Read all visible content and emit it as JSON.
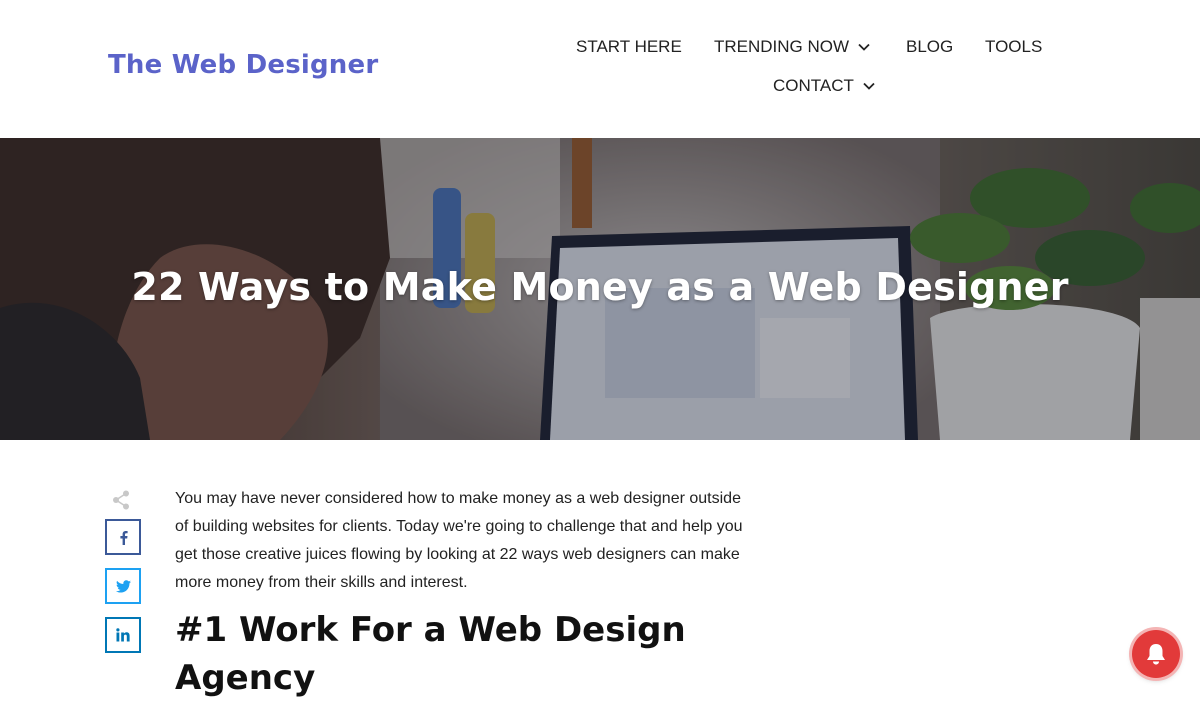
{
  "header": {
    "logo": "The Web Designer",
    "nav": [
      {
        "label": "START HERE"
      },
      {
        "label": "TRENDING NOW",
        "has_dropdown": true
      },
      {
        "label": "BLOG"
      },
      {
        "label": "TOOLS"
      },
      {
        "label": "CONTACT",
        "has_dropdown": true
      }
    ]
  },
  "hero": {
    "title": "22 Ways to Make Money as a Web Designer"
  },
  "share": {
    "icon": "share-icon",
    "buttons": [
      {
        "network": "facebook",
        "icon": "facebook-icon",
        "color": "#3b5998"
      },
      {
        "network": "twitter",
        "icon": "twitter-icon",
        "color": "#1da1f2"
      },
      {
        "network": "linkedin",
        "icon": "linkedin-icon",
        "color": "#0077b5"
      }
    ]
  },
  "article": {
    "intro": "You may have never considered how to make money as a web designer outside of building websites for clients. Today we're going to challenge that and help you get those creative juices flowing by looking at 22 ways web designers can make more money from their skills and interest.",
    "heading": "#1 Work For a Web Design Agency"
  },
  "colors": {
    "logo": "#5b63c9",
    "bell": "#e23a3a"
  },
  "notification": {
    "icon": "bell-icon"
  }
}
